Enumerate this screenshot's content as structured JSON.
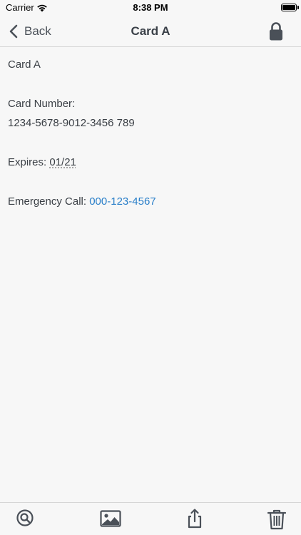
{
  "status_bar": {
    "carrier": "Carrier",
    "time": "8:38 PM",
    "wifi_icon": "wifi-icon",
    "battery_icon": "battery-icon"
  },
  "nav": {
    "back_label": "Back",
    "title": "Card A",
    "lock_icon": "lock-icon"
  },
  "note": {
    "name": "Card A",
    "card_number_label": "Card Number:",
    "card_number": "1234-5678-9012-3456 789",
    "expires_label": "Expires:",
    "expires_value": "01/21",
    "emergency_label": "Emergency Call:",
    "emergency_phone": "000-123-4567"
  },
  "toolbar": {
    "items": [
      "search-icon",
      "image-icon",
      "share-icon",
      "trash-icon"
    ]
  },
  "colors": {
    "background": "#f7f7f7",
    "text": "#3a3f45",
    "link": "#2a7fc9",
    "icon": "#4a5058"
  }
}
